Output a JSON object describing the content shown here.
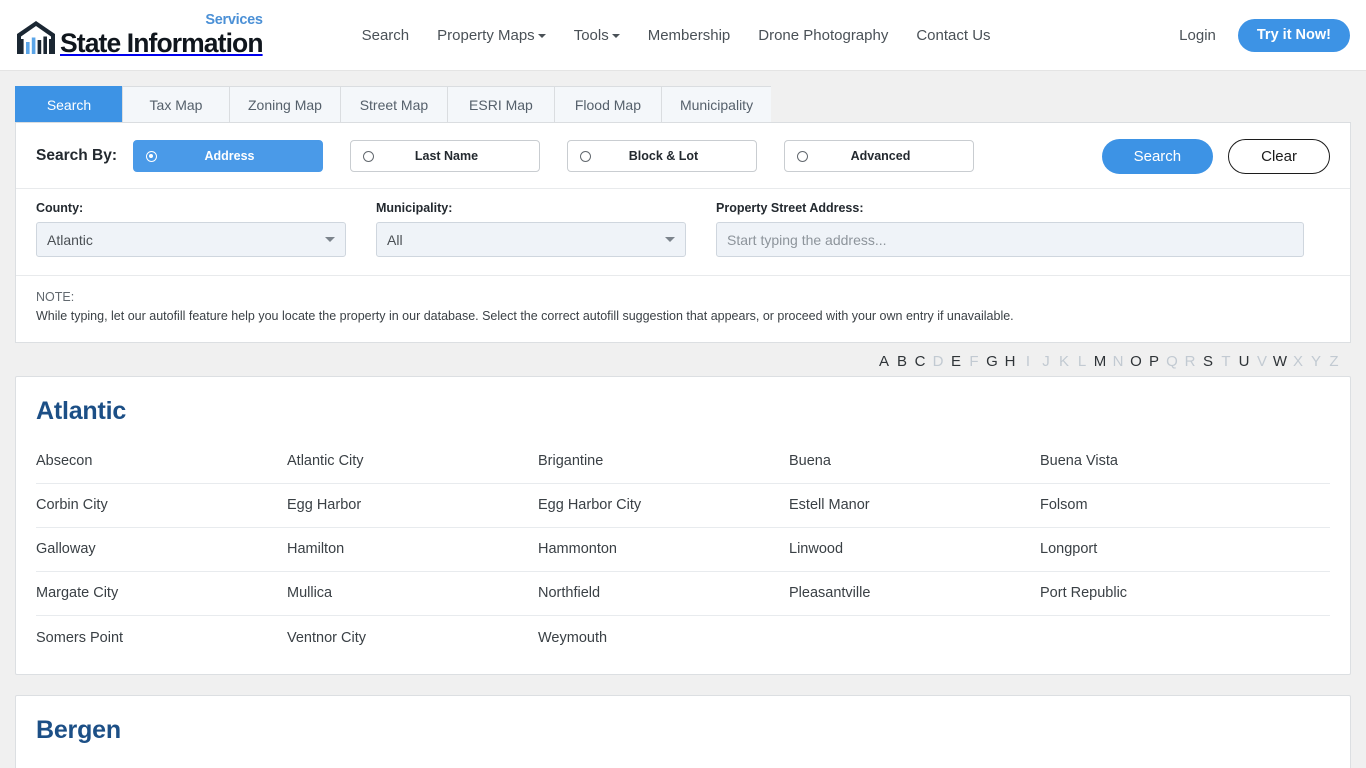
{
  "header": {
    "logo": {
      "brand": "State Information",
      "superscript": "Services",
      "icon": "building-chart-logo"
    },
    "nav": [
      {
        "label": "Search",
        "caret": false
      },
      {
        "label": "Property Maps",
        "caret": true
      },
      {
        "label": "Tools",
        "caret": true
      },
      {
        "label": "Membership",
        "caret": false
      },
      {
        "label": "Drone Photography",
        "caret": false
      },
      {
        "label": "Contact Us",
        "caret": false
      }
    ],
    "login_label": "Login",
    "cta_label": "Try it Now!",
    "accent_color": "#3d93e5"
  },
  "tabs": [
    {
      "label": "Search",
      "active": true
    },
    {
      "label": "Tax Map",
      "active": false
    },
    {
      "label": "Zoning Map",
      "active": false
    },
    {
      "label": "Street Map",
      "active": false
    },
    {
      "label": "ESRI Map",
      "active": false
    },
    {
      "label": "Flood Map",
      "active": false
    },
    {
      "label": "Municipality",
      "active": false
    }
  ],
  "search": {
    "search_by_label": "Search By:",
    "options": [
      {
        "label": "Address",
        "selected": true
      },
      {
        "label": "Last Name",
        "selected": false
      },
      {
        "label": "Block & Lot",
        "selected": false
      },
      {
        "label": "Advanced",
        "selected": false
      }
    ],
    "search_button": "Search",
    "clear_button": "Clear",
    "county": {
      "label": "County:",
      "value": "Atlantic"
    },
    "municipality": {
      "label": "Municipality:",
      "value": "All"
    },
    "address": {
      "label": "Property Street Address:",
      "value": "",
      "placeholder": "Start typing the address..."
    },
    "note_title": "NOTE:",
    "note_text": "While typing, let our autofill feature help you locate the property in our database. Select the correct autofill suggestion that appears, or proceed with your own entry if unavailable."
  },
  "alphabet": [
    {
      "letter": "A",
      "enabled": true
    },
    {
      "letter": "B",
      "enabled": true
    },
    {
      "letter": "C",
      "enabled": true
    },
    {
      "letter": "D",
      "enabled": false
    },
    {
      "letter": "E",
      "enabled": true
    },
    {
      "letter": "F",
      "enabled": false
    },
    {
      "letter": "G",
      "enabled": true
    },
    {
      "letter": "H",
      "enabled": true
    },
    {
      "letter": "I",
      "enabled": false
    },
    {
      "letter": "J",
      "enabled": false
    },
    {
      "letter": "K",
      "enabled": false
    },
    {
      "letter": "L",
      "enabled": false
    },
    {
      "letter": "M",
      "enabled": true
    },
    {
      "letter": "N",
      "enabled": false
    },
    {
      "letter": "O",
      "enabled": true
    },
    {
      "letter": "P",
      "enabled": true
    },
    {
      "letter": "Q",
      "enabled": false
    },
    {
      "letter": "R",
      "enabled": false
    },
    {
      "letter": "S",
      "enabled": true
    },
    {
      "letter": "T",
      "enabled": false
    },
    {
      "letter": "U",
      "enabled": true
    },
    {
      "letter": "V",
      "enabled": false
    },
    {
      "letter": "W",
      "enabled": true
    },
    {
      "letter": "X",
      "enabled": false
    },
    {
      "letter": "Y",
      "enabled": false
    },
    {
      "letter": "Z",
      "enabled": false
    }
  ],
  "counties": [
    {
      "name": "Atlantic",
      "rows": [
        [
          "Absecon",
          "Atlantic City",
          "Brigantine",
          "Buena",
          "Buena Vista"
        ],
        [
          "Corbin City",
          "Egg Harbor",
          "Egg Harbor City",
          "Estell Manor",
          "Folsom"
        ],
        [
          "Galloway",
          "Hamilton",
          "Hammonton",
          "Linwood",
          "Longport"
        ],
        [
          "Margate City",
          "Mullica",
          "Northfield",
          "Pleasantville",
          "Port Republic"
        ],
        [
          "Somers Point",
          "Ventnor City",
          "Weymouth",
          "",
          ""
        ]
      ]
    },
    {
      "name": "Bergen",
      "rows": []
    }
  ]
}
